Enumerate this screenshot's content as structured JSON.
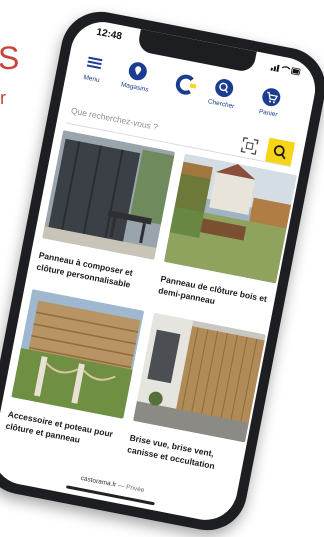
{
  "side_text": {
    "s": "S",
    "r": "r"
  },
  "status_bar": {
    "time": "12:48"
  },
  "nav": {
    "items": [
      {
        "label": "Menu",
        "icon": "menu-icon"
      },
      {
        "label": "Magasins",
        "icon": "store-pin-icon"
      },
      {
        "label": "",
        "icon": "brand-logo"
      },
      {
        "label": "Chercher",
        "icon": "search-icon"
      },
      {
        "label": "Panier",
        "icon": "cart-icon"
      }
    ]
  },
  "search": {
    "placeholder": "Que recherchez-vous ?",
    "scan_icon": "barcode-scan-icon",
    "go_icon": "search-icon"
  },
  "products": [
    {
      "title": "Panneau à composer et clôture personnalisable"
    },
    {
      "title": "Panneau de clôture bois et demi-panneau"
    },
    {
      "title": "Accessoire et poteau pour clôture et panneau"
    },
    {
      "title": "Brise vue, brise vent, canisse et occultation"
    }
  ],
  "footer": {
    "domain": "castorama.fr",
    "separator": "—",
    "mode": "Privée"
  },
  "colors": {
    "brand_blue": "#1a3d8f",
    "accent_yellow": "#f7d417",
    "side_red": "#c8443a"
  }
}
